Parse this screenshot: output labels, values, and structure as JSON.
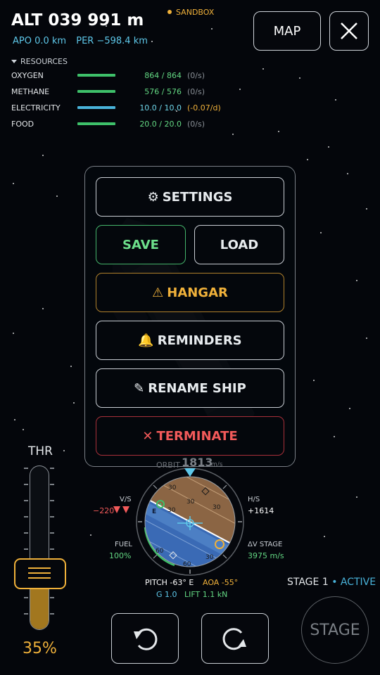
{
  "header": {
    "altitude": "ALT 039 991 m",
    "apoapsis": "APO 0.0 km",
    "periapsis": "PER −598.4 km",
    "mode_badge": "SANDBOX",
    "map_button": "MAP",
    "close_icon": "close-icon"
  },
  "resources": {
    "title": "RESOURCES",
    "items": [
      {
        "name": "OXYGEN",
        "value": "864 / 864",
        "rate": "(0/s)"
      },
      {
        "name": "METHANE",
        "value": "576 / 576",
        "rate": "(0/s)"
      },
      {
        "name": "ELECTRICITY",
        "value": "10.0 / 10.0",
        "rate": "(-0.07/d)"
      },
      {
        "name": "FOOD",
        "value": "20.0 / 20.0",
        "rate": "(0/s)"
      }
    ]
  },
  "menu": {
    "settings": {
      "icon": "⚙",
      "label": "SETTINGS"
    },
    "save": "SAVE",
    "load": "LOAD",
    "hangar": {
      "icon": "⚠",
      "label": "HANGAR"
    },
    "reminders": {
      "icon": "🔔",
      "label": "REMINDERS"
    },
    "rename": {
      "icon": "✎",
      "label": "RENAME SHIP"
    },
    "terminate": {
      "icon": "✕",
      "label": "TERMINATE"
    }
  },
  "throttle": {
    "label": "THR",
    "percent": "35%",
    "level": 0.35
  },
  "navball": {
    "speed_mode": "ORBIT",
    "speed": "1813",
    "speed_unit": "m/s",
    "vs_label": "V/S",
    "vs_value": "−220",
    "hs_label": "H/S",
    "hs_value": "+1614",
    "fuel_label": "FUEL",
    "fuel_value": "100%",
    "dv_label": "ΔV STAGE",
    "dv_value": "3975 m/s",
    "pitch": "PITCH -63°  E",
    "aoa": "AOA -55°",
    "g": "G 1.0",
    "lift": "LIFT 1.1 kN",
    "ball_labels": [
      "30",
      "30",
      "30",
      "60",
      "60",
      "30",
      "30",
      "E"
    ]
  },
  "stage": {
    "label": "STAGE 1",
    "status": "• ACTIVE",
    "button": "STAGE"
  },
  "colors": {
    "accent_orange": "#f0b13a",
    "accent_green": "#6de08b",
    "accent_cyan": "#49b3da",
    "danger": "#f25a5a"
  }
}
